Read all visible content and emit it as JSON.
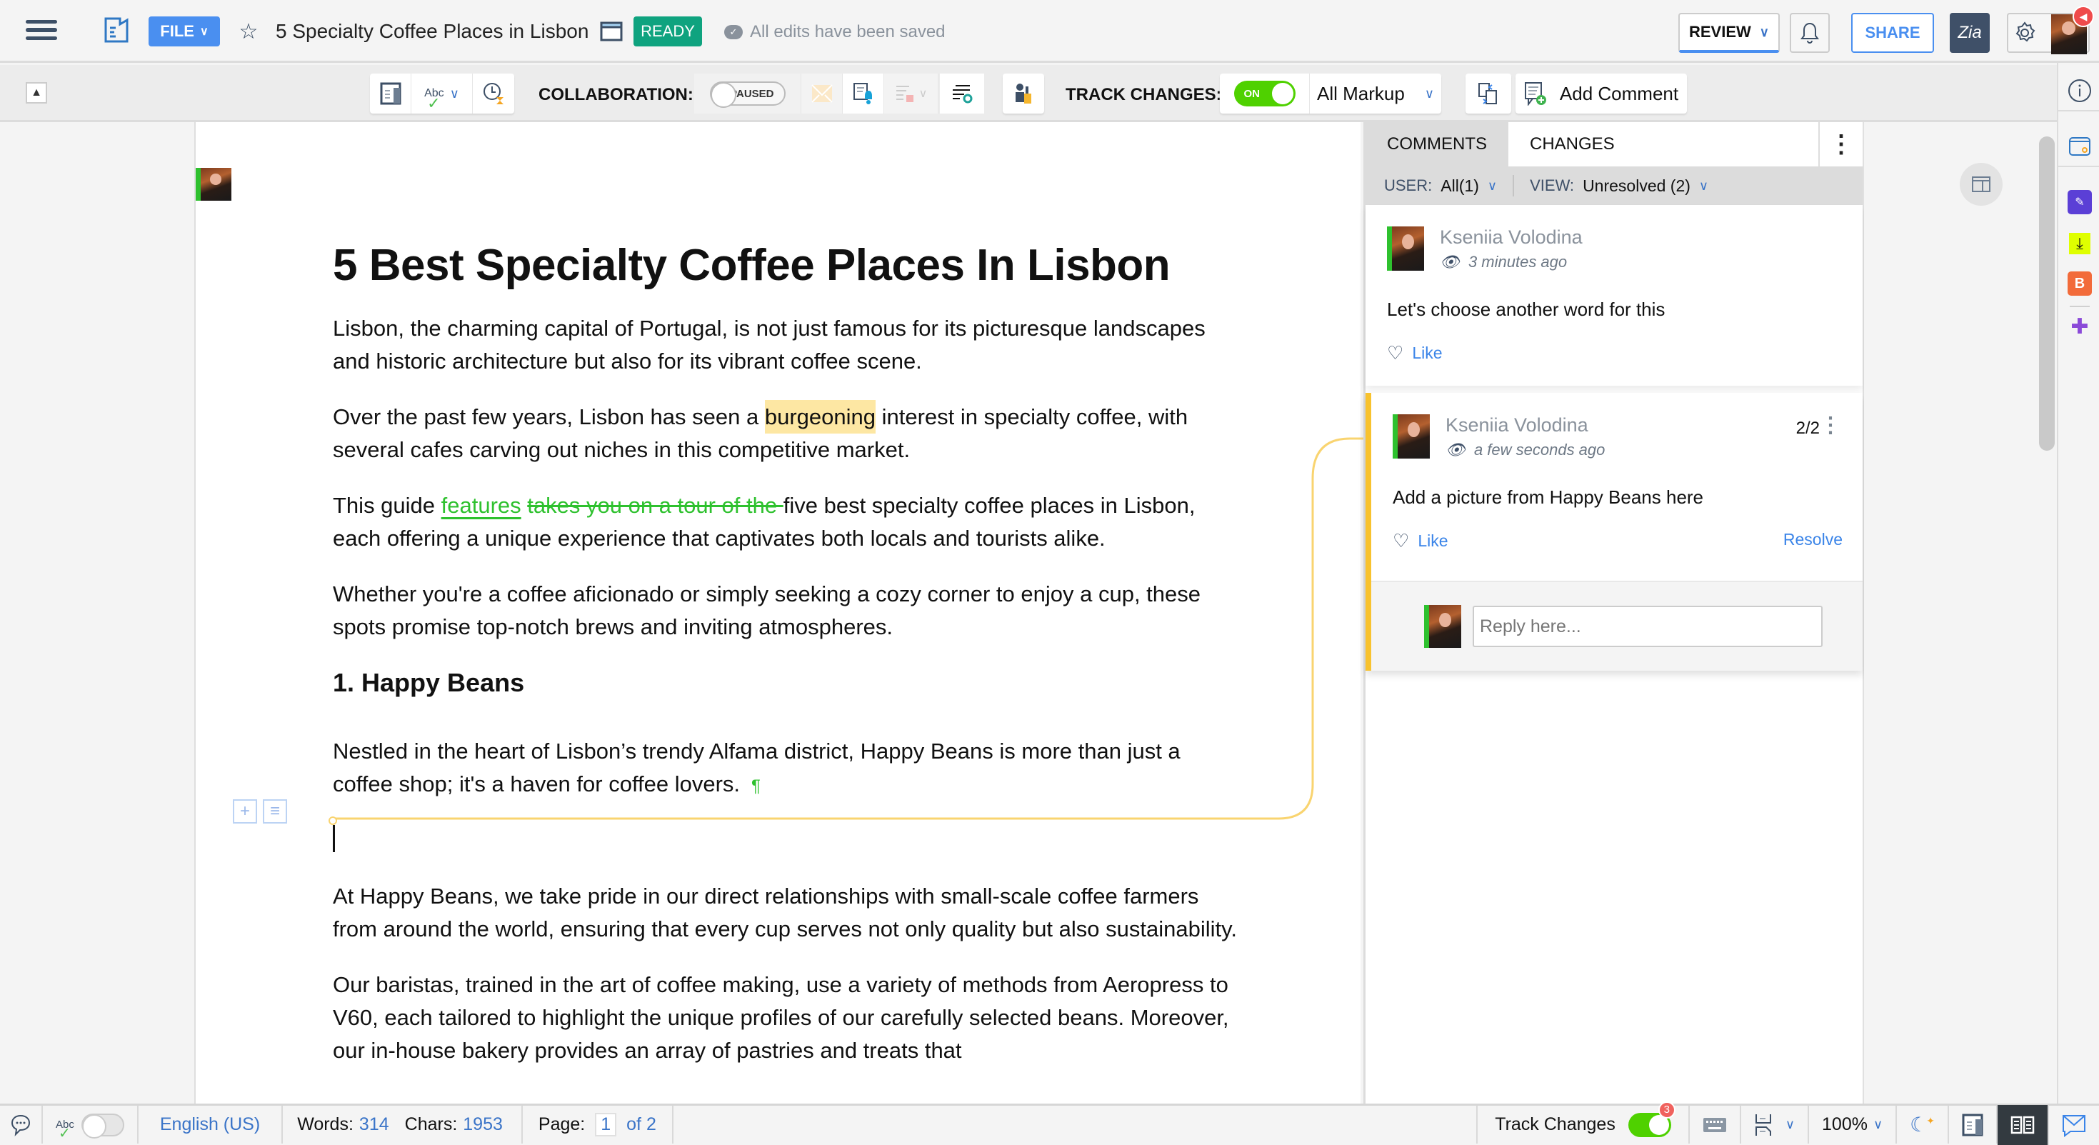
{
  "topbar": {
    "file_label": "FILE",
    "doc_title": "5 Specialty Coffee Places in Lisbon",
    "status_badge": "READY",
    "save_status": "All edits have been saved",
    "review_label": "REVIEW",
    "share_label": "SHARE",
    "zia_label": "Zia",
    "colors": {
      "accent": "#4a8ff0",
      "ready": "#0fa37f",
      "zia": "#3f5068"
    }
  },
  "toolbar": {
    "collaboration_label": "COLLABORATION:",
    "collaboration_state": "PAUSED",
    "track_changes_label": "TRACK CHANGES:",
    "track_changes_state": "ON",
    "markup_select": "All Markup",
    "add_comment_label": "Add Comment"
  },
  "document": {
    "title": "5 Best Specialty Coffee Places In Lisbon",
    "p1": "Lisbon, the charming capital of Portugal, is not just famous for its picturesque landscapes and historic architecture but also for its vibrant coffee scene.",
    "p2_before": "Over the past few years, Lisbon has seen a ",
    "p2_highlight": "burgeoning",
    "p2_after": " interest in specialty coffee, with several cafes carving out niches in this competitive market.",
    "p3_before": "This guide ",
    "p3_inserted": "features",
    "p3_deleted": "takes you on a tour of the ",
    "p3_after": "five best specialty coffee places in Lisbon, each offering a unique experience that captivates both locals and tourists alike.",
    "p4": "Whether you're a coffee aficionado or simply seeking a cozy corner to enjoy a cup, these spots promise top-notch brews and inviting atmospheres.",
    "h2": "1. Happy Beans",
    "p5": "Nestled in the heart of Lisbon’s trendy Alfama district, Happy Beans is more than just a coffee shop; it's a haven for coffee lovers.",
    "pilcrow": "¶",
    "p6": "At Happy Beans, we take pride in our direct relationships with small-scale coffee farmers from around the world, ensuring that every cup serves not only quality but also sustainability.",
    "p7": "Our baristas, trained in the art of coffee making, use a variety of methods from Aeropress to V60, each tailored to highlight the unique profiles of our carefully selected beans. Moreover, our in-house bakery provides an array of pastries and treats that"
  },
  "comments_panel": {
    "tabs": [
      {
        "label": "COMMENTS",
        "active": true
      },
      {
        "label": "CHANGES",
        "active": false
      }
    ],
    "filter_user_label": "USER:",
    "filter_user_value": "All(1)",
    "filter_view_label": "VIEW:",
    "filter_view_value": "Unresolved (2)",
    "comments": [
      {
        "author": "Kseniia Volodina",
        "time": "3 minutes ago",
        "text": "Let's choose another word for this",
        "like_label": "Like"
      },
      {
        "author": "Kseniia Volodina",
        "time": "a few seconds ago",
        "text": "Add a picture from Happy Beans here",
        "like_label": "Like",
        "resolve_label": "Resolve",
        "count": "2/2"
      }
    ],
    "reply_placeholder": "Reply here..."
  },
  "statusbar": {
    "language": "English (US)",
    "words_label": "Words:",
    "words_value": "314",
    "chars_label": "Chars:",
    "chars_value": "1953",
    "page_label": "Page:",
    "page_current": "1",
    "page_total": "of 2",
    "track_changes_label": "Track Changes",
    "track_changes_count": "3",
    "zoom": "100%"
  }
}
